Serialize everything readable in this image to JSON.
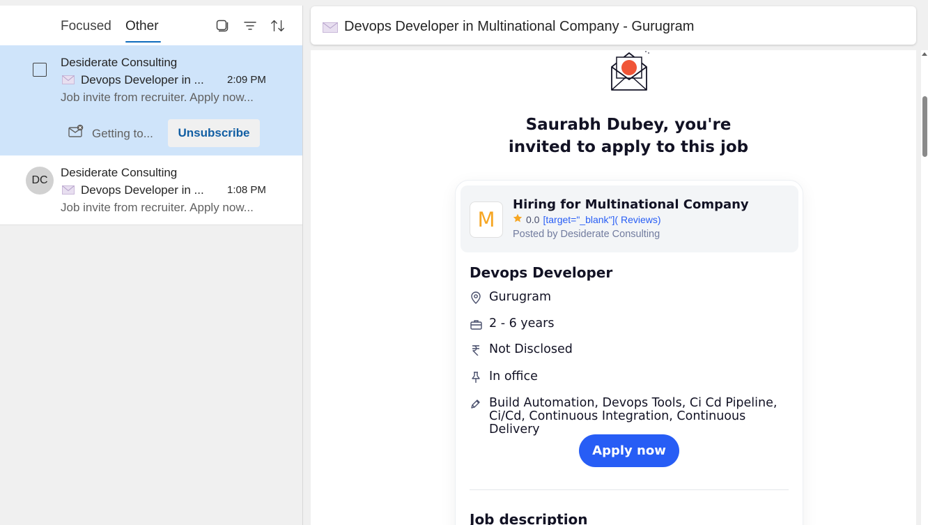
{
  "list": {
    "tabs": [
      {
        "label": "Focused",
        "active": false
      },
      {
        "label": "Other",
        "active": true
      }
    ],
    "icons": [
      "select-mode-icon",
      "filter-icon",
      "sort-icon"
    ],
    "items": [
      {
        "sender": "Desiderate Consulting",
        "subject": "Devops Developer in ...",
        "time": "2:09 PM",
        "preview": "Job invite from recruiter. Apply now...",
        "category": "Getting to...",
        "unsubscribe": "Unsubscribe",
        "selected": true
      },
      {
        "sender": "Desiderate Consulting",
        "avatar": "DC",
        "subject": "Devops Developer in ...",
        "time": "1:08 PM",
        "preview": "Job invite from recruiter. Apply now...",
        "selected": false
      }
    ]
  },
  "reading": {
    "subject": "Devops Developer in Multinational Company - Gurugram",
    "headline_line1": "Saurabh Dubey, you're",
    "headline_line2": "invited to apply to this job",
    "card": {
      "logo_letter": "M",
      "company": "Hiring for Multinational Company",
      "rating": "0.0",
      "reviews_link": "[target=\"_blank\"]( Reviews)",
      "posted_by": "Posted by Desiderate Consulting",
      "job_title": "Devops Developer",
      "location": "Gurugram",
      "experience": "2 - 6 years",
      "salary": "Not Disclosed",
      "work_mode": "In office",
      "skills": "Build Automation, Devops Tools, Ci Cd Pipeline, Ci/Cd, Continuous Integration, Continuous Delivery",
      "apply_label": "Apply now",
      "job_description_heading": "Job description"
    }
  },
  "colors": {
    "selected_row": "#cfe4fa",
    "accent": "#0f6cbd",
    "apply_button": "#275df5",
    "logo_letter": "#f6a623"
  }
}
